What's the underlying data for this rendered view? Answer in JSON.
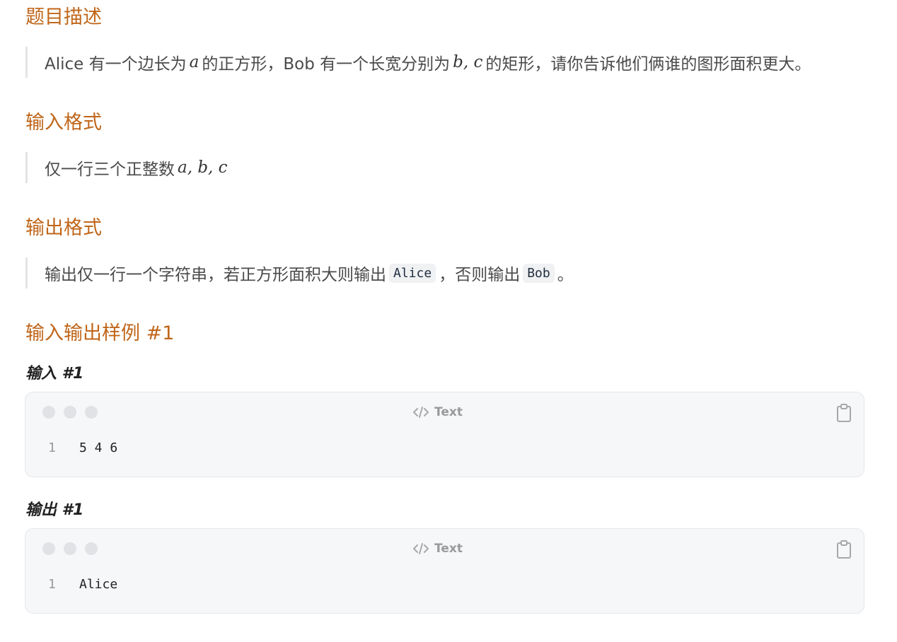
{
  "description": {
    "title": "题目描述",
    "parts": {
      "t1": "Alice 有一个边长为",
      "m1": "a",
      "t2": "的正方形，Bob 有一个长宽分别为",
      "m2": "b, c",
      "t3": "的矩形，请你告诉他们俩谁的图形面积更大。"
    }
  },
  "input_format": {
    "title": "输入格式",
    "parts": {
      "t1": "仅一行三个正整数",
      "m1": "a, b, c"
    }
  },
  "output_format": {
    "title": "输出格式",
    "parts": {
      "t1": "输出仅一行一个字符串，若正方形面积大则输出",
      "c1": "Alice",
      "t2": "，否则输出",
      "c2": "Bob",
      "t3": "。"
    }
  },
  "samples": {
    "title": "输入输出样例 #1",
    "input": {
      "label": "输入 #1",
      "lang": "Text",
      "line_number": "1",
      "code": "5 4 6"
    },
    "output": {
      "label": "输出 #1",
      "lang": "Text",
      "line_number": "1",
      "code": "Alice"
    }
  },
  "icons": {
    "code": "code-icon",
    "copy": "clipboard-icon"
  },
  "colors": {
    "heading": "#c0661a",
    "code_bg": "#f6f7f9"
  }
}
